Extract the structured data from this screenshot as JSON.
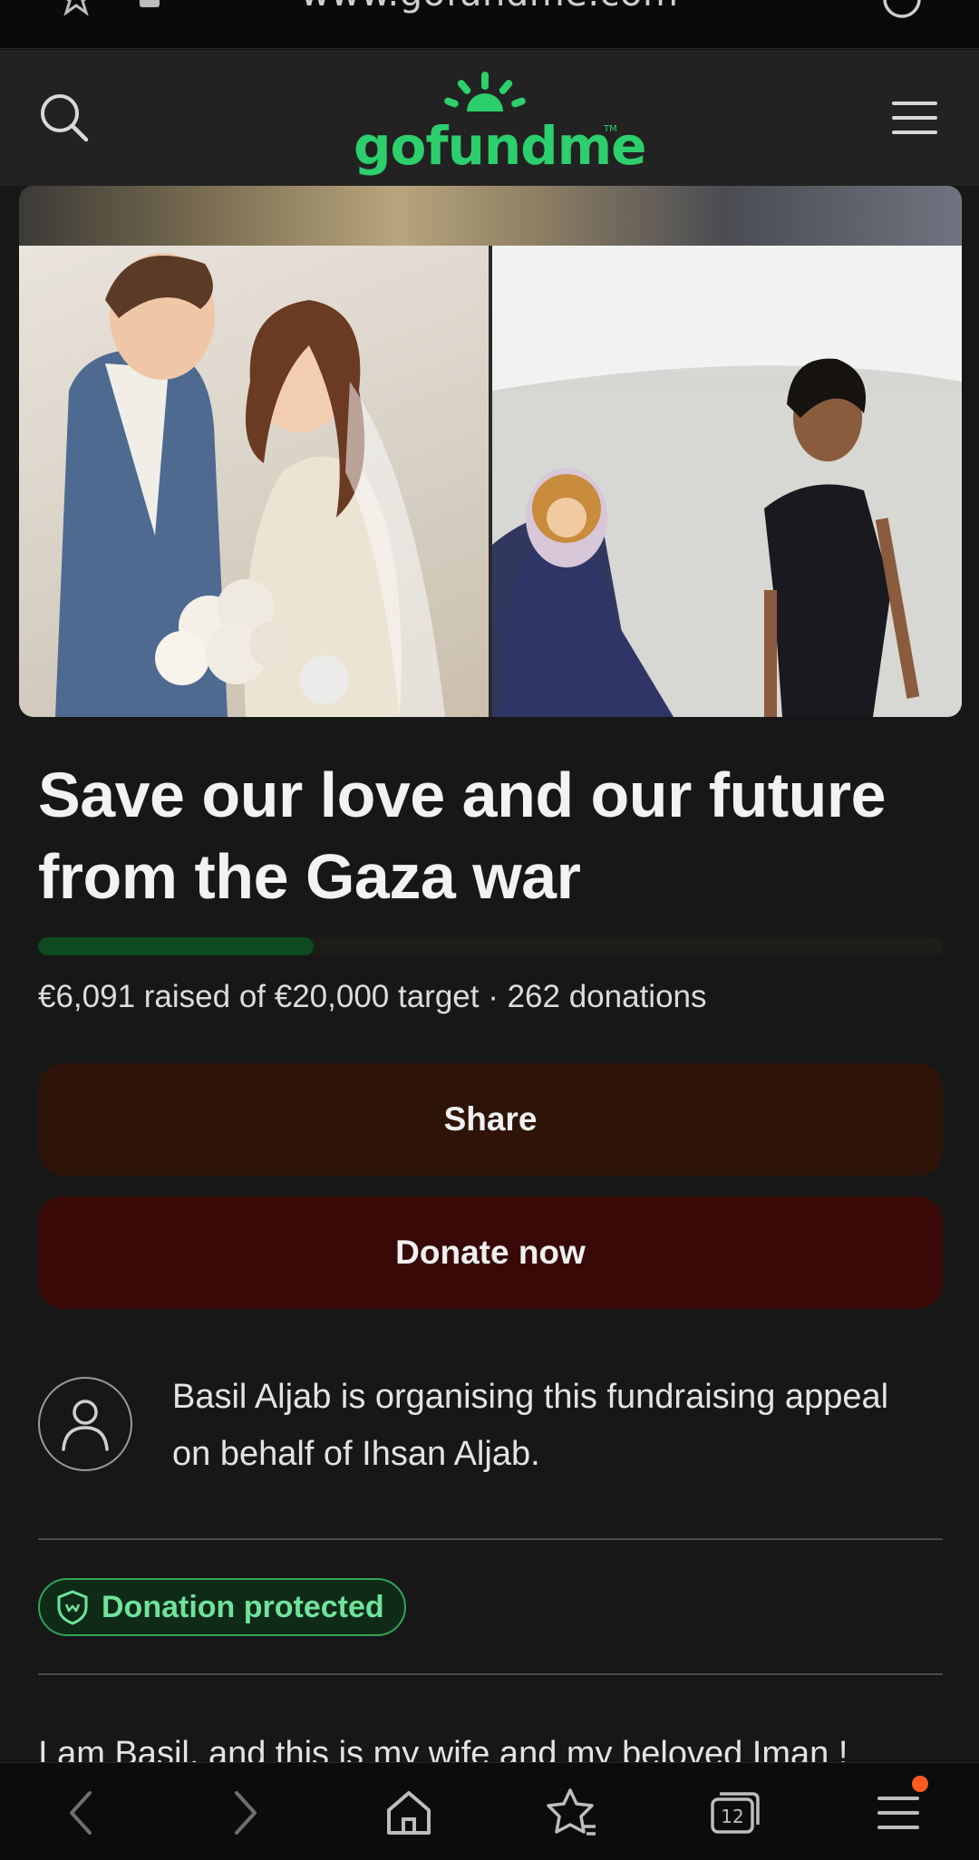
{
  "browser": {
    "url": "www.gofundme.com",
    "tab_count": "12"
  },
  "header": {
    "logo_text": "gofundme",
    "logo_tm": "TM"
  },
  "campaign": {
    "title": "Save our love and our future from the Gaza war",
    "progress_fraction": 0.305,
    "raised_text": "€6,091 raised of €20,000 target · 262 donations",
    "share_label": "Share",
    "donate_label": "Donate now",
    "organiser_text": "Basil Aljab is organising this fundraising appeal on behalf of Ihsan Aljab.",
    "badge_label": "Donation protected",
    "story_start": "I am Basil, and this is my wife and my beloved Iman !"
  },
  "colors": {
    "brand_green": "#2ccf6c",
    "share_bg": "#2e1408",
    "donate_bg": "#380906",
    "badge_border": "#2ea557"
  },
  "icons": {
    "top": [
      "star-icon",
      "lock-icon",
      "reload-icon"
    ],
    "header": [
      "search-icon",
      "menu-icon"
    ],
    "bottom": [
      "back-icon",
      "forward-icon",
      "home-icon",
      "bookmark-star-icon",
      "tabs-icon",
      "menu-icon"
    ]
  }
}
